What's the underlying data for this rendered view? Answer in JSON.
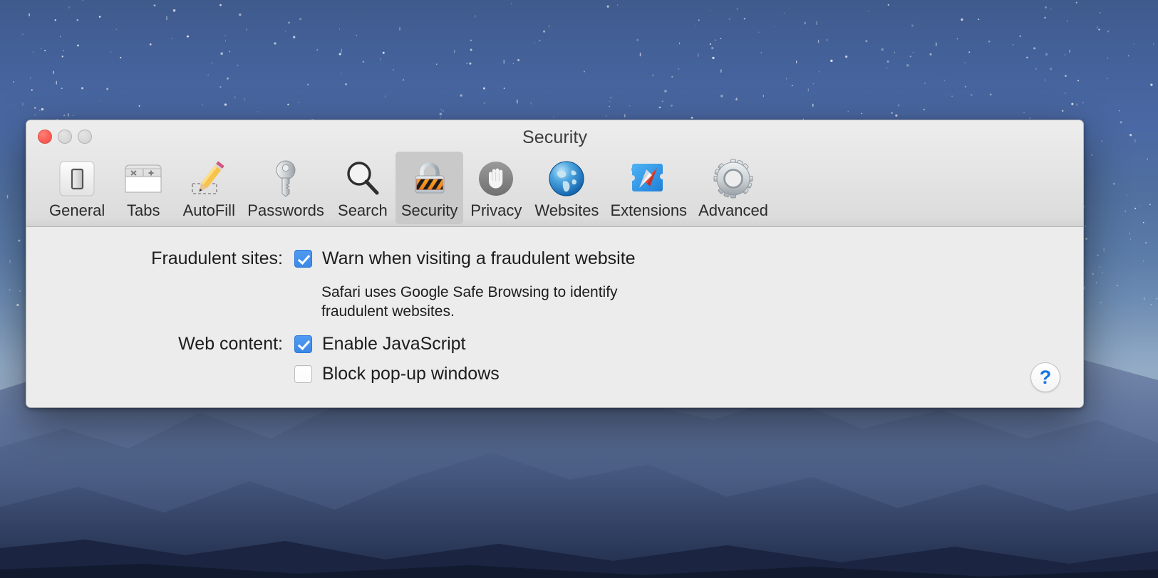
{
  "desktop": {
    "wallpaper_name": "yosemite-night-sky-wallpaper",
    "sky_color_top": "#3f5a8c",
    "sky_color_bottom": "#94abc6",
    "mountain_color": "#3c4e74"
  },
  "window": {
    "title": "Security",
    "traffic_lights": [
      {
        "name": "close-button",
        "color": "#fb5f55",
        "label": "Close"
      },
      {
        "name": "minimize-button",
        "color": "#d8d8d8",
        "label": "Minimize"
      },
      {
        "name": "zoom-button",
        "color": "#d8d8d8",
        "label": "Zoom"
      }
    ]
  },
  "toolbar": {
    "selected": "Security",
    "selected_bg": "#c9c9c9",
    "items": [
      {
        "label": "General",
        "icon": "switch-icon",
        "selected": false
      },
      {
        "label": "Tabs",
        "icon": "tabs-icon",
        "selected": false
      },
      {
        "label": "AutoFill",
        "icon": "pencil-icon",
        "selected": false
      },
      {
        "label": "Passwords",
        "icon": "key-icon",
        "selected": false
      },
      {
        "label": "Search",
        "icon": "magnifier-icon",
        "selected": false
      },
      {
        "label": "Security",
        "icon": "padlock-icon",
        "selected": true
      },
      {
        "label": "Privacy",
        "icon": "hand-icon",
        "selected": false
      },
      {
        "label": "Websites",
        "icon": "globe-icon",
        "selected": false
      },
      {
        "label": "Extensions",
        "icon": "puzzle-compass-icon",
        "selected": false
      },
      {
        "label": "Advanced",
        "icon": "gear-icon",
        "selected": false
      }
    ]
  },
  "content": {
    "fraudulent_sites": {
      "label": "Fraudulent sites:",
      "checkbox_label": "Warn when visiting a fraudulent website",
      "checked": true,
      "helper_text": "Safari uses Google Safe Browsing to identify fraudulent websites."
    },
    "web_content": {
      "label": "Web content:",
      "options": [
        {
          "label": "Enable JavaScript",
          "checked": true
        },
        {
          "label": "Block pop-up windows",
          "checked": false
        }
      ]
    },
    "help_button": {
      "glyph": "?",
      "title": "Help",
      "color": "#1274e0"
    }
  }
}
